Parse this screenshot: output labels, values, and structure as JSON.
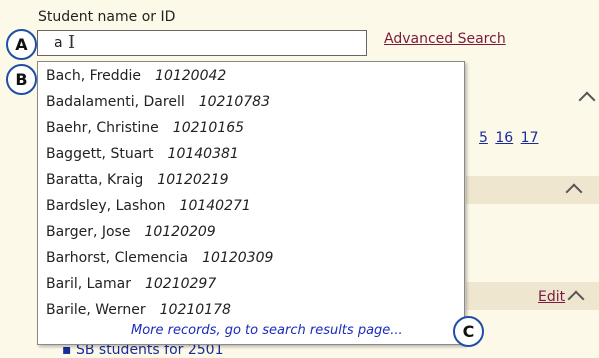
{
  "field_label": "Student name or ID",
  "search": {
    "value": "a",
    "placeholder": ""
  },
  "advanced_search_label": "Advanced Search",
  "page_links": [
    "5",
    "16",
    "17"
  ],
  "edit_label": "Edit",
  "bullet_item": "SB students for 2501",
  "results": [
    {
      "name": "Bach, Freddie",
      "id": "10120042"
    },
    {
      "name": "Badalamenti, Darell",
      "id": "10210783"
    },
    {
      "name": "Baehr, Christine",
      "id": "10210165"
    },
    {
      "name": "Baggett, Stuart",
      "id": "10140381"
    },
    {
      "name": "Baratta, Kraig",
      "id": "10120219"
    },
    {
      "name": "Bardsley, Lashon",
      "id": "10140271"
    },
    {
      "name": "Barger, Jose",
      "id": "10120209"
    },
    {
      "name": "Barhorst, Clemencia",
      "id": "10120309"
    },
    {
      "name": "Baril, Lamar",
      "id": "10210297"
    },
    {
      "name": "Barile, Werner",
      "id": "10210178"
    }
  ],
  "more_records_label": "More records, go to search results page...",
  "markers": {
    "a": "A",
    "b": "B",
    "c": "C"
  },
  "icons": {
    "collapse": "chevron-up-icon",
    "cursor": "text-cursor-icon"
  },
  "colors": {
    "panel_bg": "#fdf9e8",
    "band_bg": "#efe6cf",
    "link": "#7b1a3c",
    "more_link": "#1a2cbc",
    "marker_border": "#1f4ea8"
  }
}
